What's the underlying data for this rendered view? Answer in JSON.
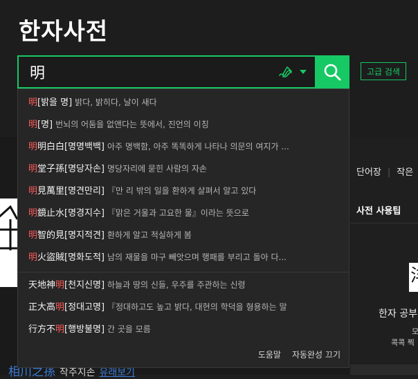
{
  "header": {
    "title": "한자사전"
  },
  "search": {
    "value": "明",
    "icon": "search-icon",
    "advanced_label": "고급 검색"
  },
  "colors": {
    "accent": "#17c964",
    "highlight": "#ff5a5a"
  },
  "suggestions": [
    {
      "pre": "",
      "hl": "明",
      "post": "[밝을 명]",
      "desc": "밝다, 밝히다, 날이 새다"
    },
    {
      "pre": "",
      "hl": "明",
      "post": "[명]",
      "desc": "번뇌의 어둠을 없앤다는 뜻에서, 진언의 이칭"
    },
    {
      "pre": "",
      "hl": "明",
      "post": "明白白[명명백백]",
      "desc": "아주 명백함, 아주 똑똑하게 나타나 의문의 여지가 ..."
    },
    {
      "pre": "",
      "hl": "明",
      "post": "堂子孫[명당자손]",
      "desc": "명당자리에 묻힌 사람의 자손"
    },
    {
      "pre": "",
      "hl": "明",
      "post": "見萬里[명견만리]",
      "desc": "『만 리 밖의 일을 환하게 살펴서 알고 있다"
    },
    {
      "pre": "",
      "hl": "明",
      "post": "鏡止水[명경지수]",
      "desc": "『맑은 거울과 고요한 물』이라는 뜻으로"
    },
    {
      "pre": "",
      "hl": "明",
      "post": "智的見[명지적견]",
      "desc": "환하게 알고 적실하게 봄"
    },
    {
      "pre": "",
      "hl": "明",
      "post": "火盜賊[명화도적]",
      "desc": "남의 재물을 마구 빼앗으며 행패를 부리고 돌아 다..."
    },
    {
      "pre": "天地神",
      "hl": "明",
      "post": "[천지신명]",
      "desc": "하늘과 땅의 신들, 우주를 주관하는 신령"
    },
    {
      "pre": "正大高",
      "hl": "明",
      "post": "[정대고명]",
      "desc": "『정대하고도 높고 밝다, 대현의 학덕을 형용하는 말"
    },
    {
      "pre": "行方不",
      "hl": "明",
      "post": "[행방불명]",
      "desc": "간 곳을 모름"
    }
  ],
  "footer": {
    "help": "도움말",
    "autocomplete_off": "자동완성 끄기"
  },
  "right_panel": {
    "tab1": "단어장",
    "tab2": "작은",
    "tips_title": "사전 사용팁",
    "thumb_glyph": "洋",
    "text1": "한자 공부",
    "text2": "모",
    "text3": "콕콕 찍"
  },
  "peek": {
    "blue": "相川之孫",
    "mid": "작주지손",
    "blue2": "유래보기"
  }
}
